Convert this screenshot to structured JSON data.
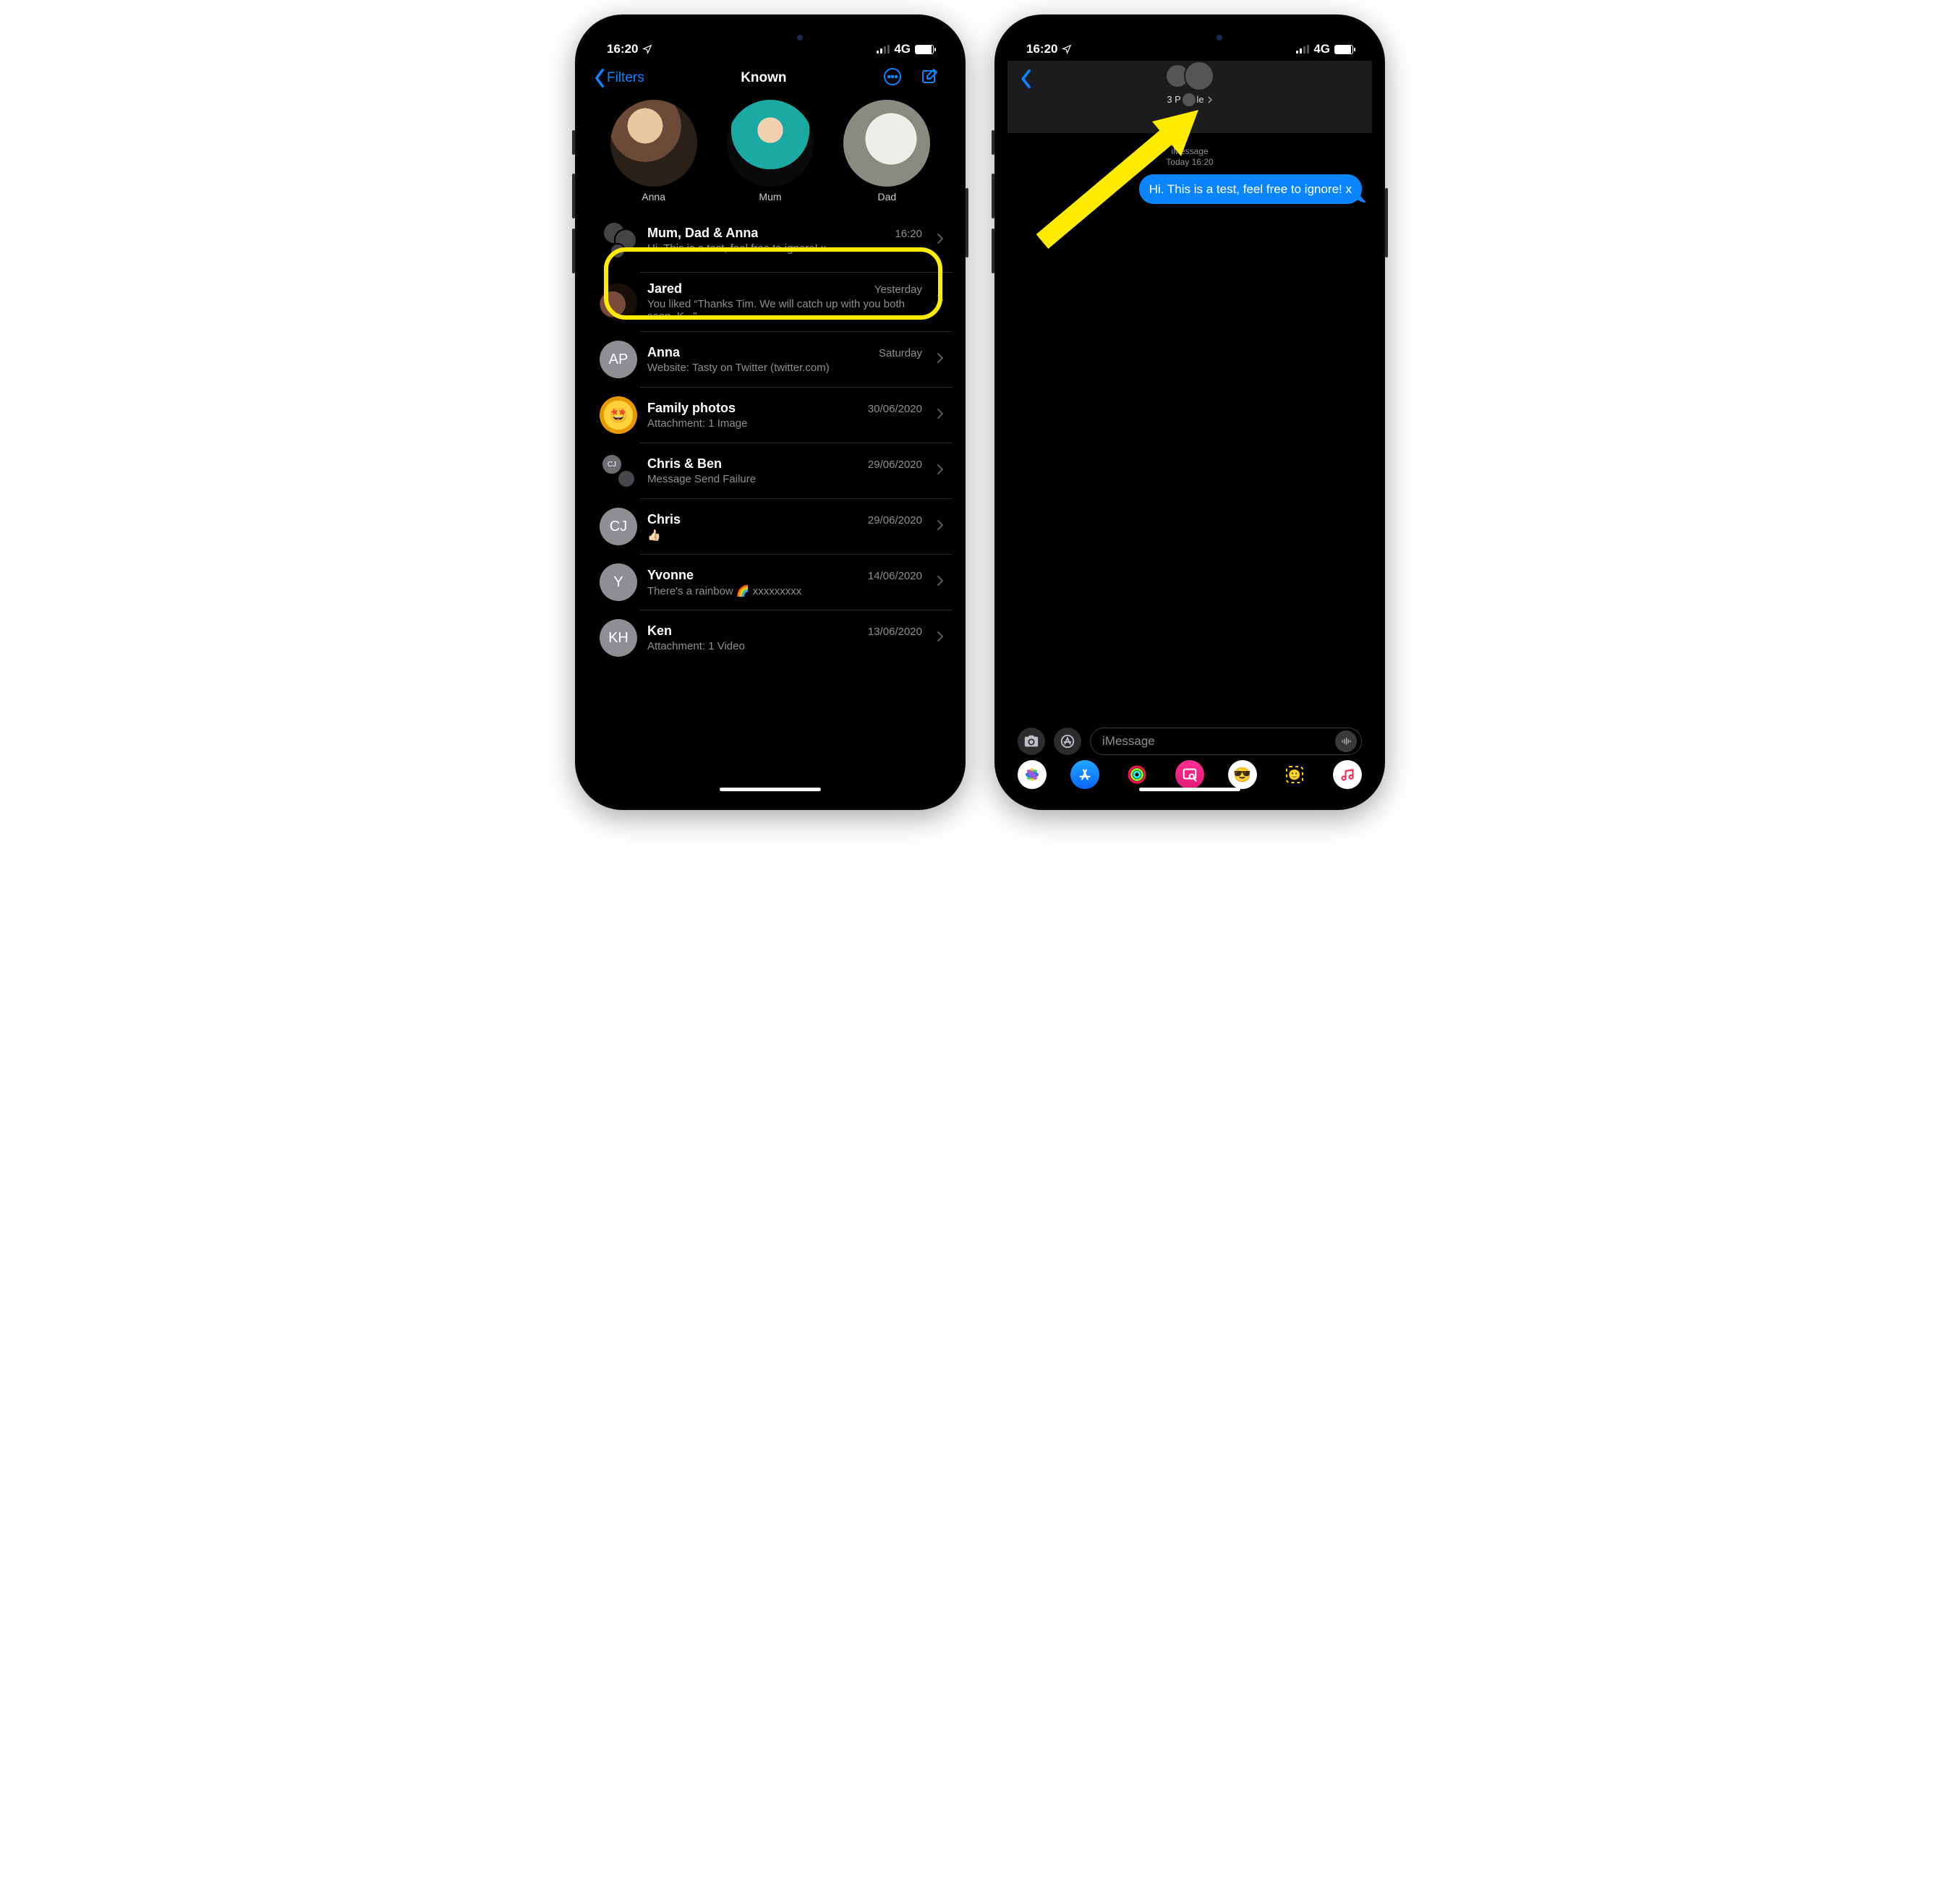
{
  "statusbar": {
    "time": "16:20",
    "network": "4G"
  },
  "left": {
    "filters_label": "Filters",
    "title": "Known",
    "pinned": [
      {
        "name": "Anna"
      },
      {
        "name": "Mum"
      },
      {
        "name": "Dad"
      }
    ],
    "conversations": [
      {
        "name": "Mum, Dad & Anna",
        "time": "16:20",
        "preview": "Hi. This is a test, feel free to ignore! x",
        "avatar": "group",
        "highlighted": true
      },
      {
        "name": "Jared",
        "time": "Yesterday",
        "preview": "You liked “Thanks Tim. We will catch up with you both soon. K...”",
        "avatar": "photo"
      },
      {
        "name": "Anna",
        "time": "Saturday",
        "preview": "Website: Tasty on Twitter (twitter.com)",
        "avatar": "AP"
      },
      {
        "name": "Family photos",
        "time": "30/06/2020",
        "preview": "Attachment: 1 Image",
        "avatar": "star"
      },
      {
        "name": "Chris & Ben",
        "time": "29/06/2020",
        "preview": "Message Send Failure",
        "avatar": "group-cj"
      },
      {
        "name": "Chris",
        "time": "29/06/2020",
        "preview": "👍🏻",
        "avatar": "CJ"
      },
      {
        "name": "Yvonne",
        "time": "14/06/2020",
        "preview": "There's a rainbow 🌈 xxxxxxxxx",
        "avatar": "Y"
      },
      {
        "name": "Ken",
        "time": "13/06/2020",
        "preview": "Attachment: 1 Video",
        "avatar": "KH"
      }
    ]
  },
  "right": {
    "group_title": "3 People",
    "timestamp_service": "iMessage",
    "timestamp_text": "Today 16:20",
    "bubble_text": "Hi. This is a test, feel free to ignore! x",
    "input_placeholder": "iMessage"
  },
  "colors": {
    "accent": "#0a84ff",
    "highlight": "#FFEB00"
  }
}
